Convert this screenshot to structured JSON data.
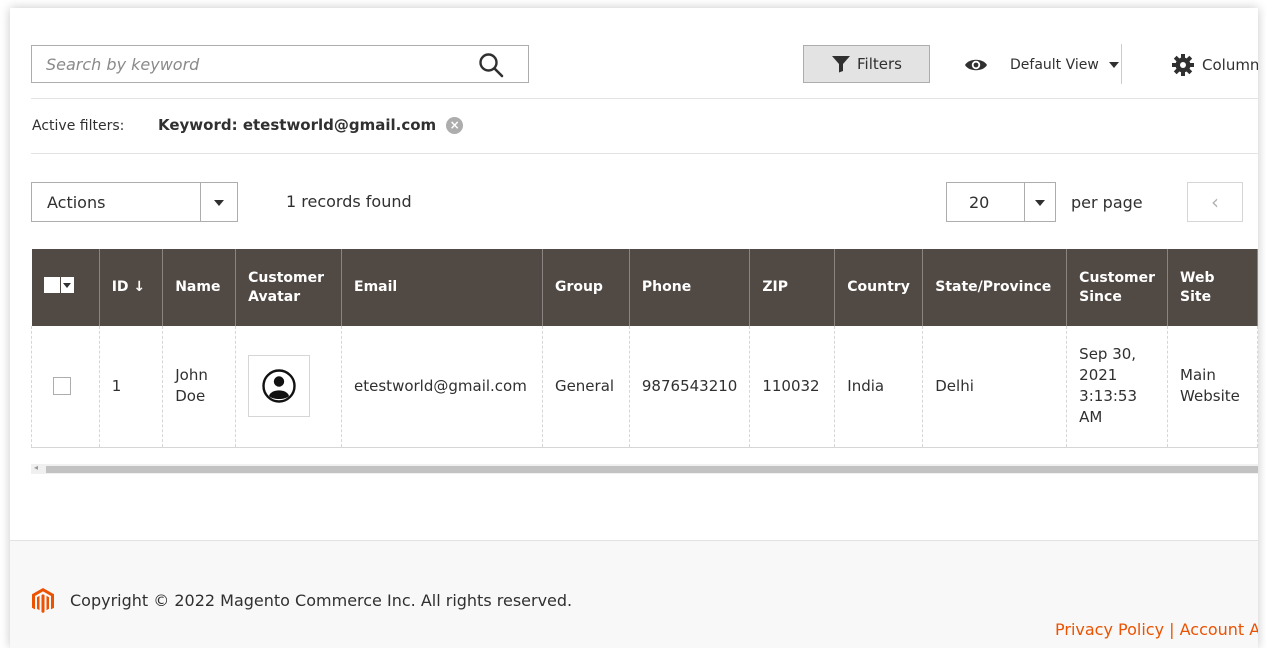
{
  "search": {
    "placeholder": "Search by keyword",
    "value": ""
  },
  "toolbar": {
    "filters_label": "Filters",
    "view_label": "Default View",
    "columns_label": "Columns"
  },
  "active_filters": {
    "label": "Active filters:",
    "chip": "Keyword: etestworld@gmail.com"
  },
  "actions": {
    "label": "Actions"
  },
  "records_found": "1 records found",
  "pagination": {
    "per_page_value": "20",
    "per_page_label": "per page",
    "prev_glyph": "‹"
  },
  "grid": {
    "headers": {
      "id": "ID ↓",
      "name": "Name",
      "avatar_line1": "Customer",
      "avatar_line2": "Avatar",
      "email": "Email",
      "group": "Group",
      "phone": "Phone",
      "zip": "ZIP",
      "country": "Country",
      "state": "State/Province",
      "since_line1": "Customer",
      "since_line2": "Since",
      "website_line1": "Web",
      "website_line2": "Site"
    },
    "rows": [
      {
        "id": "1",
        "name_line1": "John",
        "name_line2": "Doe",
        "email": "etestworld@gmail.com",
        "group": "General",
        "phone": "9876543210",
        "zip": "110032",
        "country": "India",
        "state": "Delhi",
        "since_line1": "Sep 30,",
        "since_line2": "2021",
        "since_line3": "3:13:53",
        "since_line4": "AM",
        "website_line1": "Main",
        "website_line2": "Website"
      }
    ]
  },
  "footer": {
    "copyright": "Copyright © 2022 Magento Commerce Inc. All rights reserved.",
    "links": "Privacy Policy | Account Activity"
  },
  "colors": {
    "header_bg": "#514943",
    "accent_orange": "#eb5202",
    "border": "#adadad"
  }
}
